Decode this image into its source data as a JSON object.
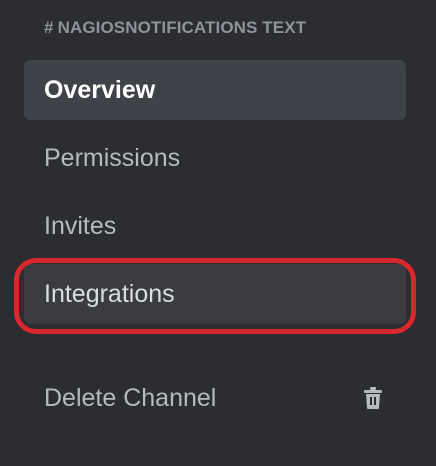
{
  "channel_header": {
    "hash": "#",
    "name": "NAGIOSNOTIFICATIONS TEXT"
  },
  "menu": {
    "items": [
      {
        "label": "Overview",
        "state": "selected"
      },
      {
        "label": "Permissions",
        "state": "normal"
      },
      {
        "label": "Invites",
        "state": "normal"
      },
      {
        "label": "Integrations",
        "state": "highlighted"
      }
    ],
    "delete": {
      "label": "Delete Channel",
      "icon": "trash-icon"
    }
  },
  "colors": {
    "background": "#2b2d31",
    "selected_bg": "#404249",
    "highlight_ring": "#d8272d",
    "text_muted": "#b5bac1"
  }
}
